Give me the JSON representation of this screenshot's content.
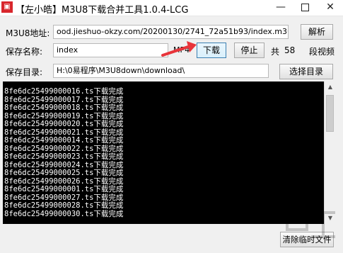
{
  "window": {
    "title": "【左小皓】M3U8下载合并工具1.0.4-LCG",
    "controls": [
      "minimize",
      "maximize",
      "close"
    ]
  },
  "form": {
    "m3u8_label": "M3U8地址:",
    "m3u8_value": "ood.jieshuo-okzy.com/20200130/2741_72a51b93/index.m3u8",
    "parse_button": "解析",
    "save_name_label": "保存名称:",
    "save_name_value": "index",
    "ext_label": "MP4",
    "download_button": "下载",
    "stop_button": "停止",
    "segments_prefix": "共",
    "segments_count": "58",
    "segments_suffix": "段视频",
    "save_dir_label": "保存目录:",
    "save_dir_value": "H:\\0易程序\\M3U8down\\download\\",
    "choose_dir_button": "选择目录"
  },
  "log": {
    "lines": [
      "8fe6dc25499000016.ts下载完成",
      "8fe6dc25499000017.ts下载完成",
      "8fe6dc25499000018.ts下载完成",
      "8fe6dc25499000019.ts下载完成",
      "8fe6dc25499000020.ts下载完成",
      "8fe6dc25499000021.ts下载完成",
      "8fe6dc25499000014.ts下载完成",
      "8fe6dc25499000022.ts下载完成",
      "8fe6dc25499000023.ts下载完成",
      "8fe6dc25499000024.ts下载完成",
      "8fe6dc25499000025.ts下载完成",
      "8fe6dc25499000026.ts下载完成",
      "8fe6dc25499000001.ts下载完成",
      "8fe6dc25499000027.ts下载完成",
      "8fe6dc25499000028.ts下载完成",
      "8fe6dc25499000030.ts下载完成"
    ]
  },
  "footer": {
    "clear_temp_button": "清除临时文件"
  },
  "colors": {
    "console_bg": "#000000",
    "console_text": "#ffffff",
    "annotation_arrow": "#e8343a",
    "app_icon": "#d8262c"
  }
}
